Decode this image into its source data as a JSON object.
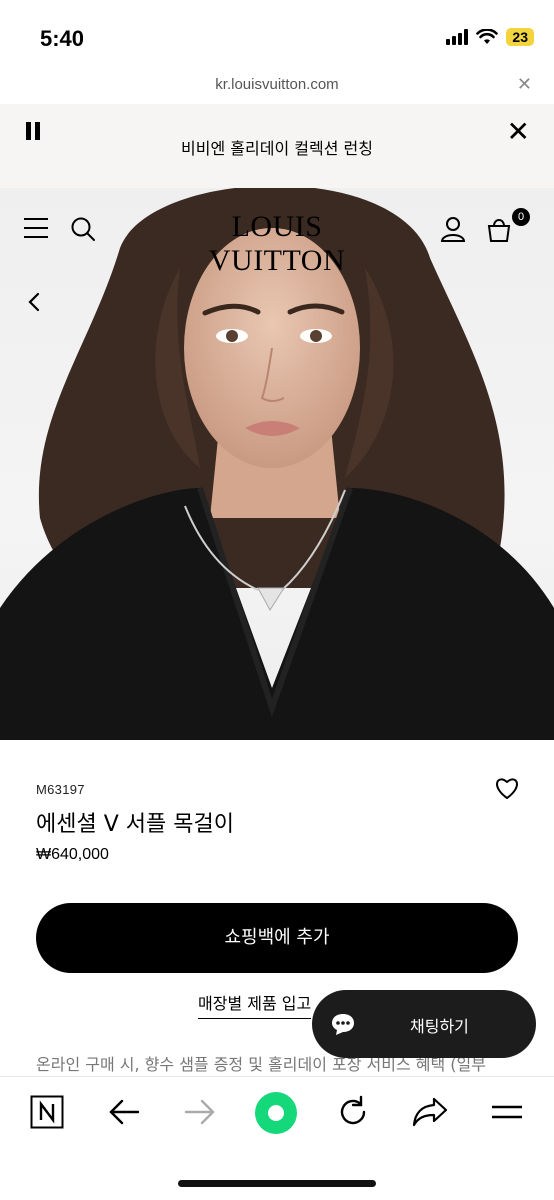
{
  "status_bar": {
    "time": "5:40",
    "battery": "23"
  },
  "browser": {
    "url": "kr.louisvuitton.com",
    "close_icon": "close-icon"
  },
  "promo": {
    "text": "비비엔 홀리데이 컬렉션 런칭",
    "pause_icon": "pause-icon",
    "close_icon": "close-icon"
  },
  "header": {
    "brand": "LOUIS VUITTON",
    "bag_count": "0",
    "icons": [
      "menu-icon",
      "search-icon",
      "account-icon",
      "shopping-bag-icon"
    ]
  },
  "product": {
    "sku": "M63197",
    "name": "에센셜 V 서플 목걸이",
    "price": "₩640,000",
    "add_to_bag": "쇼핑백에 추가",
    "store_availability": "매장별 제품 입고",
    "notice": "온라인 구매 시, 향수 샘플 증정 및 홀리데이 포장 서비스 혜택 (일부"
  },
  "chat": {
    "label": "채팅하기"
  },
  "colors": {
    "accent": "#000000",
    "promo_bg": "#f6f5f3",
    "chat_bg": "#1c1c1c",
    "browser_home": "#14d87a"
  }
}
